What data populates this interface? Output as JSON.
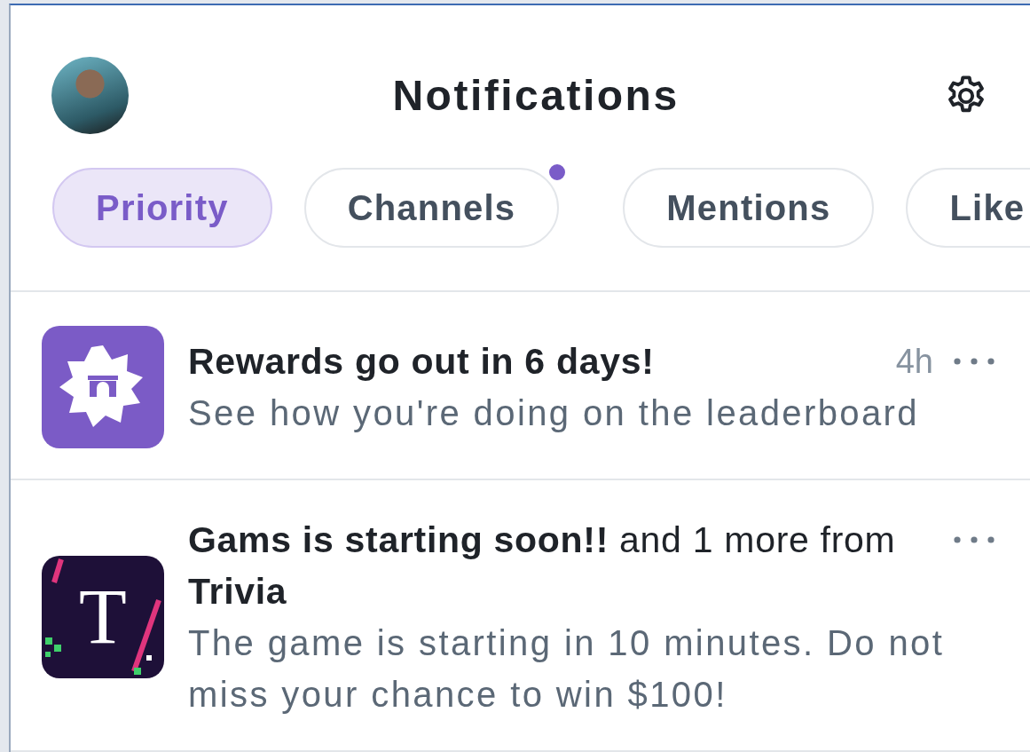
{
  "header": {
    "title": "Notifications"
  },
  "tabs": [
    {
      "label": "Priority",
      "selected": true,
      "unread": false
    },
    {
      "label": "Channels",
      "selected": false,
      "unread": true
    },
    {
      "label": "Mentions",
      "selected": false,
      "unread": false
    },
    {
      "label": "Like",
      "selected": false,
      "unread": false
    }
  ],
  "notifications": [
    {
      "kind": "rewards",
      "title": "**Rewards go out in 6 days!**",
      "time": "4h",
      "body": "See how you're doing on the leaderboard"
    },
    {
      "kind": "trivia",
      "logo_letter": "T",
      "title": "**Gams is starting soon!!** and 1 more from **Trivia**",
      "body": "The game is starting in 10 minutes. Do not miss your chance to win $100!"
    }
  ]
}
